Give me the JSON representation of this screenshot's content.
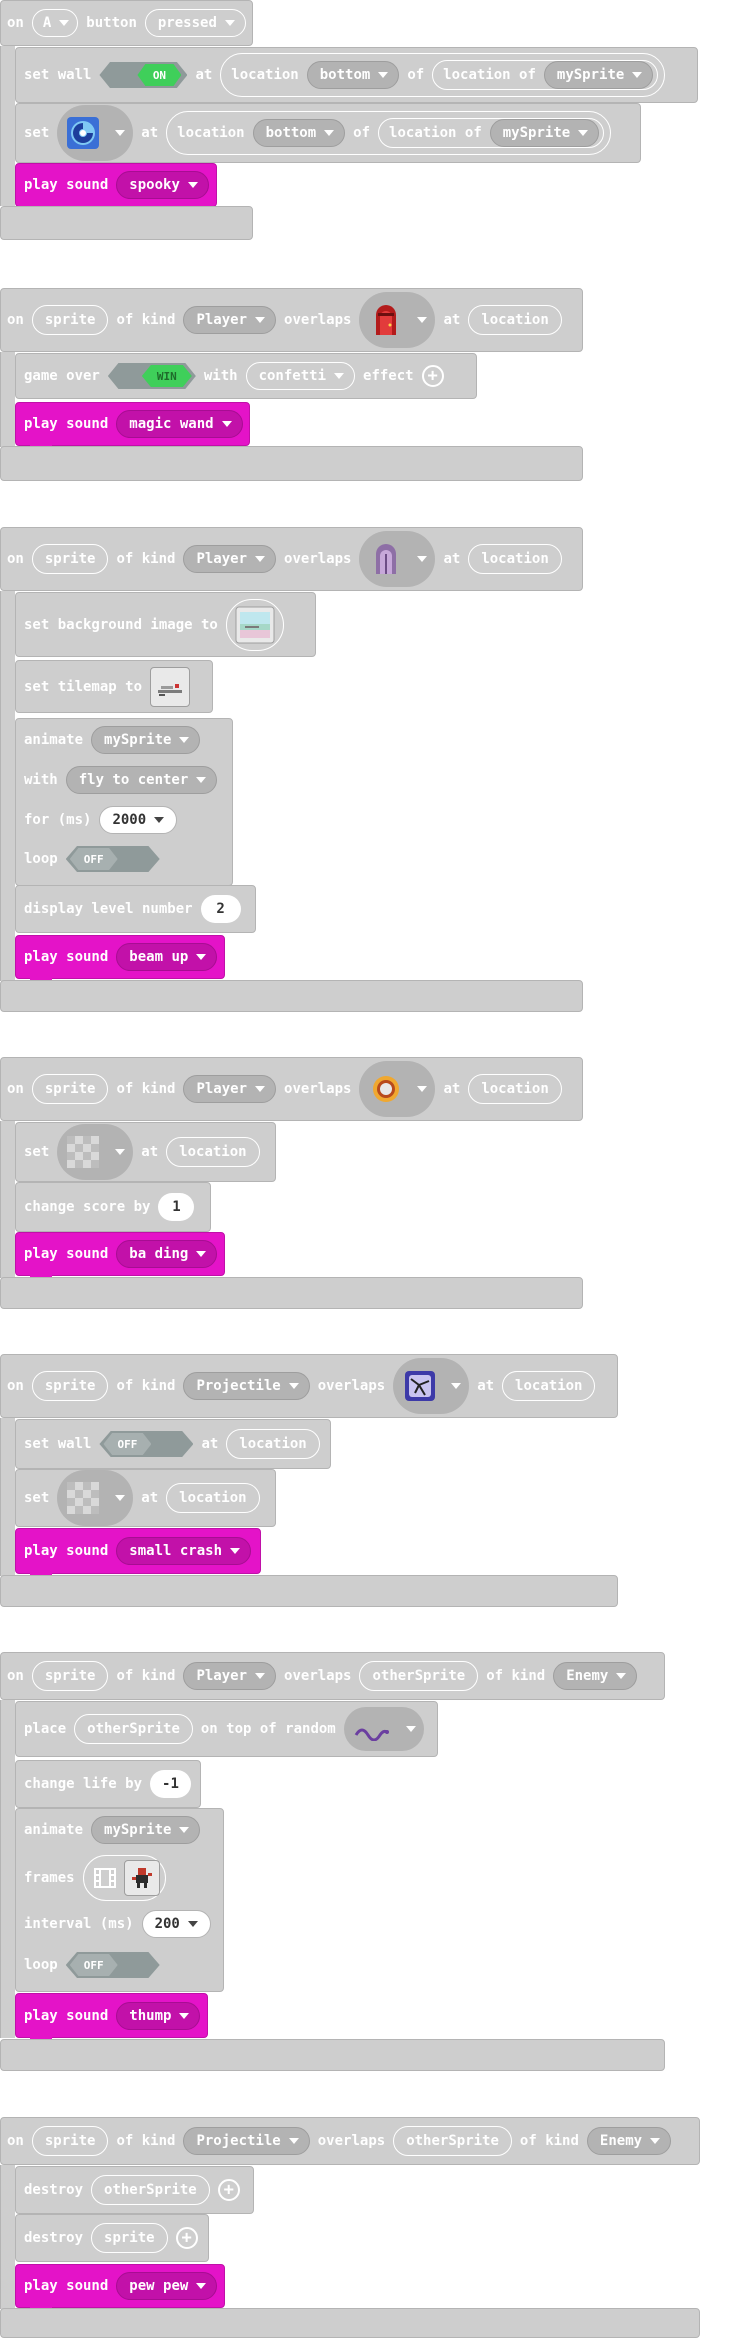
{
  "colors": {
    "block_gray": "#cecece",
    "block_border": "#b4b4b4",
    "sound_pink": "#e413c8",
    "dropdown_gray": "#b3b3b3",
    "toggle_on": "#3fcf5a",
    "toggle_off": "#8f9a9a"
  },
  "groups": [
    {
      "hat": {
        "on": "on",
        "button": "A",
        "button_word": "button",
        "event": "pressed"
      },
      "set_wall": {
        "set_wall": "set wall",
        "toggle": "ON",
        "at": "at",
        "location_word": "location",
        "location": "bottom",
        "of": "of",
        "location_of": "location of",
        "sprite": "mySprite"
      },
      "set_tile": {
        "set": "set",
        "tile_icon": "blue-swirl-tile-icon",
        "at": "at",
        "location_word": "location",
        "location": "bottom",
        "of": "of",
        "location_of": "location of",
        "sprite": "mySprite"
      },
      "play": {
        "play_sound": "play sound",
        "sound": "spooky"
      }
    },
    {
      "hat": {
        "on": "on",
        "sprite": "sprite",
        "of_kind": "of kind",
        "kind": "Player",
        "overlaps": "overlaps",
        "tile_icon": "red-door-tile-icon",
        "at": "at",
        "location": "location"
      },
      "game_over": {
        "game_over": "game over",
        "toggle": "WIN",
        "with": "with",
        "effect_value": "confetti",
        "effect": "effect"
      },
      "play": {
        "play_sound": "play sound",
        "sound": "magic wand"
      }
    },
    {
      "hat": {
        "on": "on",
        "sprite": "sprite",
        "of_kind": "of kind",
        "kind": "Player",
        "overlaps": "overlaps",
        "tile_icon": "purple-door-tile-icon",
        "at": "at",
        "location": "location"
      },
      "set_bg": {
        "label": "set background image to",
        "icon": "background-image-icon"
      },
      "set_tilemap": {
        "label": "set tilemap to",
        "icon": "tilemap-icon"
      },
      "animate": {
        "animate": "animate",
        "sprite": "mySprite",
        "with": "with",
        "effect": "fly to center",
        "for": "for (ms)",
        "ms": "2000",
        "loop": "loop",
        "loop_value": "OFF"
      },
      "display_level": {
        "label": "display level number",
        "value": "2"
      },
      "play": {
        "play_sound": "play sound",
        "sound": "beam up"
      }
    },
    {
      "hat": {
        "on": "on",
        "sprite": "sprite",
        "of_kind": "of kind",
        "kind": "Player",
        "overlaps": "overlaps",
        "tile_icon": "gold-ring-tile-icon",
        "at": "at",
        "location": "location"
      },
      "set_tile": {
        "set": "set",
        "tile_icon": "transparent-tile-icon",
        "at": "at",
        "location": "location"
      },
      "change_score": {
        "label": "change score by",
        "value": "1"
      },
      "play": {
        "play_sound": "play sound",
        "sound": "ba ding"
      }
    },
    {
      "hat": {
        "on": "on",
        "sprite": "sprite",
        "of_kind": "of kind",
        "kind": "Projectile",
        "overlaps": "overlaps",
        "tile_icon": "cracked-block-tile-icon",
        "at": "at",
        "location": "location"
      },
      "set_wall": {
        "set_wall": "set wall",
        "toggle": "OFF",
        "at": "at",
        "location": "location"
      },
      "set_tile": {
        "set": "set",
        "tile_icon": "transparent-tile-icon",
        "at": "at",
        "location": "location"
      },
      "play": {
        "play_sound": "play sound",
        "sound": "small crash"
      }
    },
    {
      "hat": {
        "on": "on",
        "sprite": "sprite",
        "of_kind": "of kind",
        "kind": "Player",
        "overlaps": "overlaps",
        "other": "otherSprite",
        "of_kind2": "of kind",
        "kind2": "Enemy"
      },
      "place": {
        "place": "place",
        "sprite": "otherSprite",
        "on_top": "on top of random",
        "tile_icon": "purple-worm-tile-icon"
      },
      "change_life": {
        "label": "change life by",
        "value": "-1"
      },
      "animate": {
        "animate": "animate",
        "sprite": "mySprite",
        "frames": "frames",
        "interval": "interval (ms)",
        "ms": "200",
        "loop": "loop",
        "loop_value": "OFF"
      },
      "play": {
        "play_sound": "play sound",
        "sound": "thump"
      }
    },
    {
      "hat": {
        "on": "on",
        "sprite": "sprite",
        "of_kind": "of kind",
        "kind": "Projectile",
        "overlaps": "overlaps",
        "other": "otherSprite",
        "of_kind2": "of kind",
        "kind2": "Enemy"
      },
      "destroy1": {
        "label": "destroy",
        "sprite": "otherSprite"
      },
      "destroy2": {
        "label": "destroy",
        "sprite": "sprite"
      },
      "play": {
        "play_sound": "play sound",
        "sound": "pew pew"
      }
    }
  ]
}
